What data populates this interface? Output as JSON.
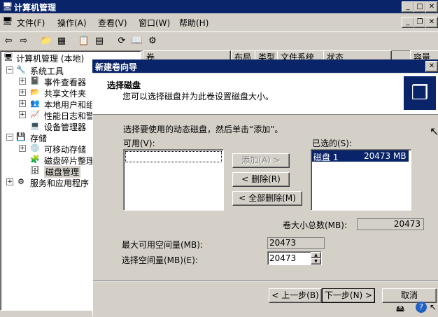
{
  "window": {
    "title": "计算机管理"
  },
  "menu": [
    "文件(F)",
    "操作(A)",
    "查看(V)",
    "窗口(W)",
    "帮助(H)"
  ],
  "tree": {
    "root": "计算机管理 (本地)",
    "system_tools": "系统工具",
    "event_viewer": "事件查看器",
    "shared_folders": "共享文件夹",
    "local_users": "本地用户和组",
    "perf_logs": "性能日志和警",
    "device_manager": "设备管理器",
    "storage": "存储",
    "removable": "可移动存储",
    "defrag": "磁盘碎片整理",
    "disk_mgmt": "磁盘管理",
    "services": "服务和应用程序"
  },
  "columns": [
    "卷",
    "布局",
    "类型",
    "文件系统",
    "状态",
    "容量"
  ],
  "wizard": {
    "title": "新建卷向导",
    "heading": "选择磁盘",
    "subheading": "您可以选择磁盘并为此卷设置磁盘大小。",
    "instruction": "选择要使用的动态磁盘，然后单击“添加”。",
    "available_label": "可用(V):",
    "selected_label": "已选的(S):",
    "selected_items": [
      {
        "name": "磁盘 1",
        "size": "20473 MB"
      }
    ],
    "add_button": "添加(A) >",
    "remove_button": "< 删除(R)",
    "remove_all_button": "< 全部删除(M)",
    "total_label": "卷大小总数(MB):",
    "total_value": "20473",
    "max_label": "最大可用空间量(MB):",
    "max_value": "20473",
    "select_label": "选择空间量(MB)(E):",
    "select_value": "20473",
    "back_button": "< 上一步(B)",
    "next_button": "下一步(N) >",
    "cancel_button": "取消"
  }
}
